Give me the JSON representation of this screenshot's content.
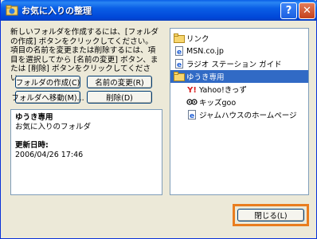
{
  "window": {
    "title": "お気に入りの整理"
  },
  "instructions": "新しいフォルダを作成するには、[フォルダの作成] ボタンをクリックしてください。項目の名前を変更または削除するには、項目を選択してから [名前の変更] ボタン、または [削除] ボタンをクリックしてください。",
  "buttons": {
    "create_folder": "フォルダの作成(C)",
    "rename": "名前の変更(R)",
    "move_to_folder": "フォルダへ移動(M)...",
    "delete": "削除(D)",
    "close": "閉じる(L)"
  },
  "info": {
    "name": "ゆうき専用",
    "type": "お気に入りのフォルダ",
    "updated_label": "更新日時:",
    "updated_value": "2006/04/26 17:46"
  },
  "favorites": [
    {
      "label": "リンク",
      "icon": "folder-icon",
      "level": 0
    },
    {
      "label": "MSN.co.jp",
      "icon": "ie-page-icon",
      "level": 0
    },
    {
      "label": "ラジオ ステーション ガイド",
      "icon": "ie-page-icon",
      "level": 0
    },
    {
      "label": "ゆうき専用",
      "icon": "folder-open-icon",
      "level": 0,
      "selected": true
    },
    {
      "label": "Yahoo!きっず",
      "icon": "yahoo-icon",
      "level": 1
    },
    {
      "label": "キッズgoo",
      "icon": "goo-icon",
      "level": 1
    },
    {
      "label": "ジャムハウスのホームページ",
      "icon": "ie-page-icon",
      "level": 1
    }
  ],
  "colors": {
    "titlebar": "#0a5ee6",
    "selection": "#316ac5",
    "highlight_outline": "#e97d1e"
  }
}
